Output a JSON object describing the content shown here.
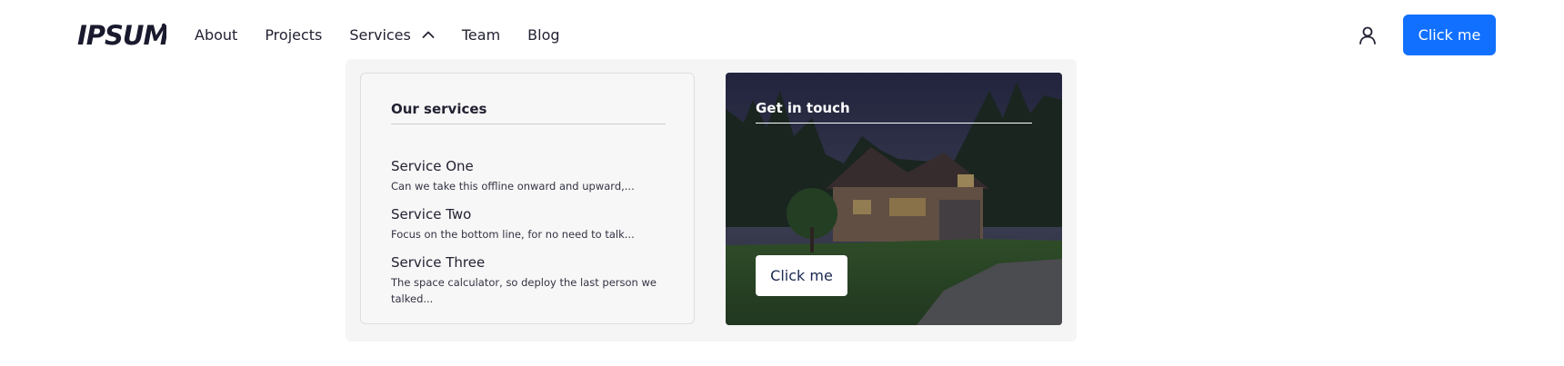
{
  "brand": {
    "logo_text": "IPSUM"
  },
  "nav": {
    "items": [
      {
        "label": "About"
      },
      {
        "label": "Projects"
      },
      {
        "label": "Services",
        "expanded": true
      },
      {
        "label": "Team"
      },
      {
        "label": "Blog"
      }
    ],
    "cta_label": "Click me",
    "icons": {
      "user": "user-icon",
      "chevron": "chevron-up-icon"
    }
  },
  "dropdown": {
    "services": {
      "heading": "Our services",
      "items": [
        {
          "title": "Service One",
          "description": "Can we take this offline onward and upward,..."
        },
        {
          "title": "Service Two",
          "description": "Focus on the bottom line, for no need to talk..."
        },
        {
          "title": "Service Three",
          "description": "The space calculator, so deploy the last person we talked..."
        }
      ]
    },
    "touch": {
      "heading": "Get in touch",
      "button_label": "Click me",
      "image": "house-photo"
    }
  },
  "colors": {
    "accent": "#1170ff",
    "panel_bg": "#f5f5f5",
    "text": "#222233"
  }
}
